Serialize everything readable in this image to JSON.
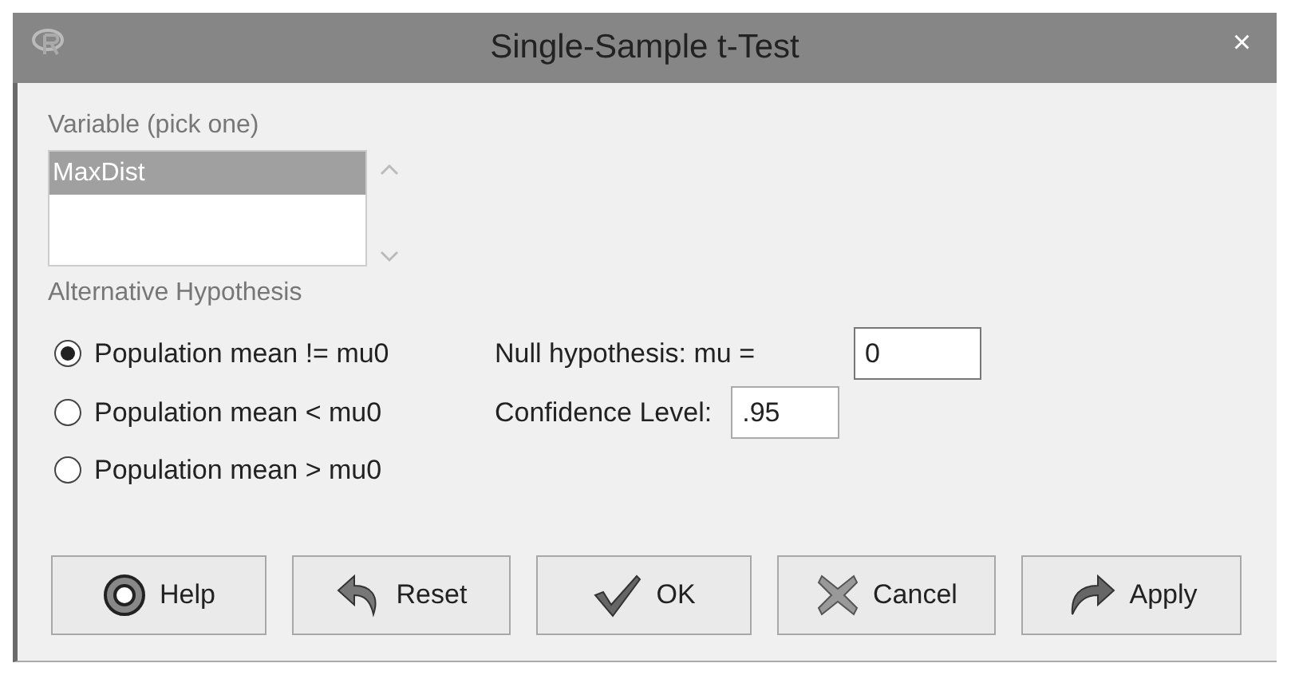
{
  "window": {
    "title": "Single-Sample t-Test",
    "close": "×"
  },
  "variable": {
    "label": "Variable (pick one)",
    "items": [
      {
        "label": "MaxDist",
        "selected": true
      }
    ]
  },
  "alternative": {
    "label": "Alternative Hypothesis",
    "options": [
      {
        "label": "Population mean != mu0",
        "selected": true
      },
      {
        "label": "Population mean < mu0",
        "selected": false
      },
      {
        "label": "Population mean > mu0",
        "selected": false
      }
    ]
  },
  "fields": [
    {
      "label": "Null hypothesis: mu =",
      "value": "0",
      "focused": true
    },
    {
      "label": "Confidence Level:",
      "value": ".95",
      "focused": false
    }
  ],
  "buttons": [
    {
      "kind": "help",
      "label": "Help"
    },
    {
      "kind": "reset",
      "label": "Reset"
    },
    {
      "kind": "ok",
      "label": "OK"
    },
    {
      "kind": "cancel",
      "label": "Cancel"
    },
    {
      "kind": "apply",
      "label": "Apply"
    }
  ]
}
